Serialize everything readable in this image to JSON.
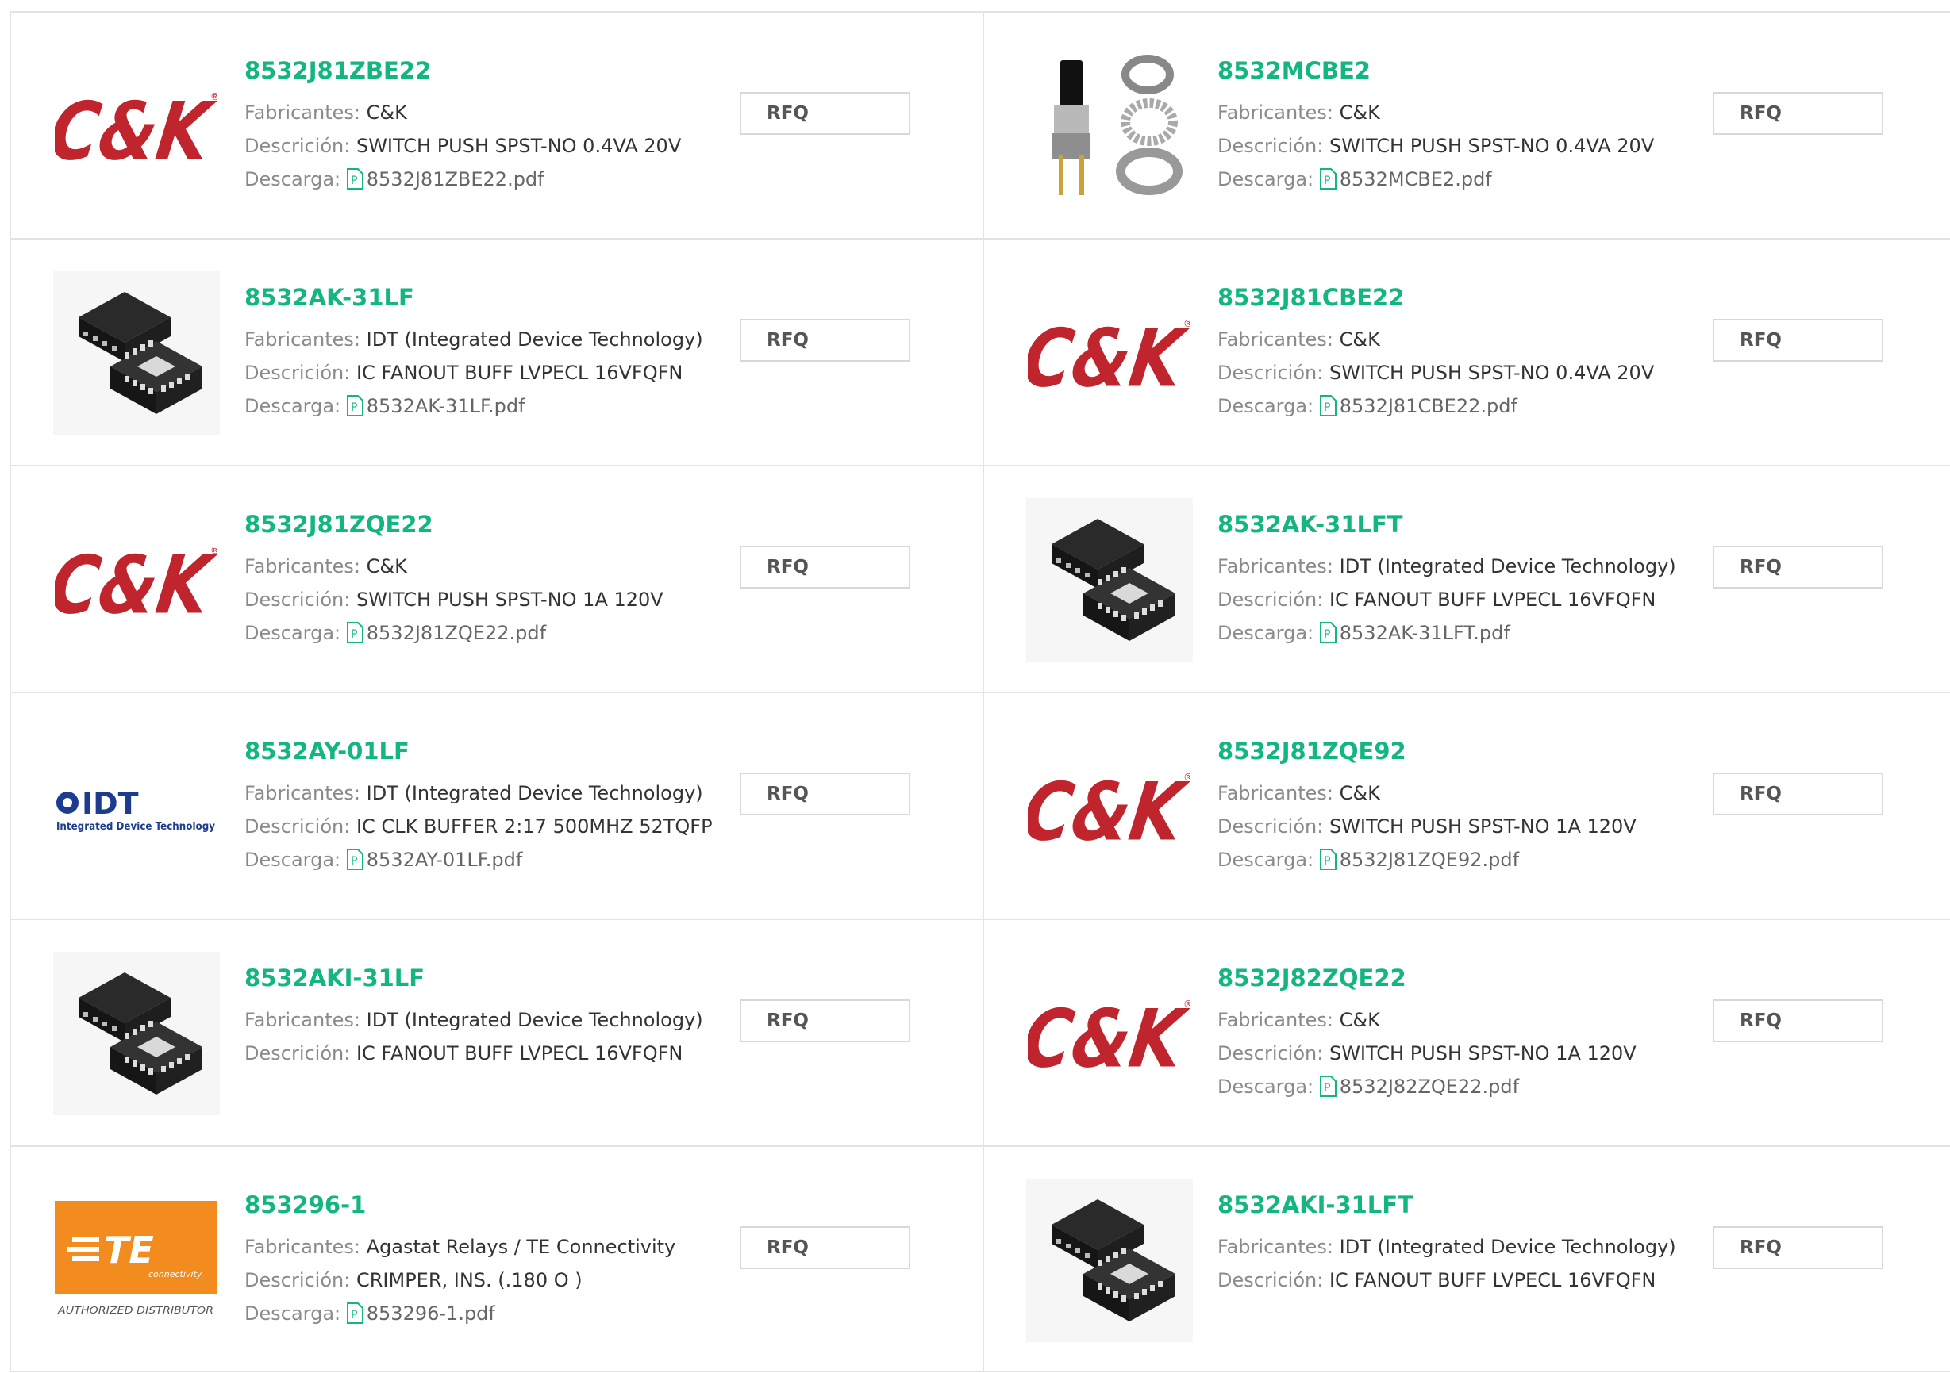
{
  "labels": {
    "manufacturer": "Fabricantes:",
    "description": "Descrición:",
    "download": "Descarga:",
    "rfq": "RFQ"
  },
  "colors": {
    "accent_green": "#13b583",
    "ck_red": "#c0242d",
    "te_orange": "#f28c1f",
    "idt_blue": "#1d3c8f"
  },
  "products": [
    {
      "part": "8532J81ZBE22",
      "manufacturer": "C&K",
      "description": "SWITCH PUSH SPST-NO 0.4VA 20V",
      "file": "8532J81ZBE22.pdf",
      "image": "ck-logo"
    },
    {
      "part": "8532MCBE2",
      "manufacturer": "C&K",
      "description": "SWITCH PUSH SPST-NO 0.4VA 20V",
      "file": "8532MCBE2.pdf",
      "image": "switch-photo"
    },
    {
      "part": "8532AK-31LF",
      "manufacturer": "IDT (Integrated Device Technology)",
      "description": "IC FANOUT BUFF LVPECL 16VFQFN",
      "file": "8532AK-31LF.pdf",
      "image": "chip-photo"
    },
    {
      "part": "8532J81CBE22",
      "manufacturer": "C&K",
      "description": "SWITCH PUSH SPST-NO 0.4VA 20V",
      "file": "8532J81CBE22.pdf",
      "image": "ck-logo"
    },
    {
      "part": "8532J81ZQE22",
      "manufacturer": "C&K",
      "description": "SWITCH PUSH SPST-NO 1A 120V",
      "file": "8532J81ZQE22.pdf",
      "image": "ck-logo"
    },
    {
      "part": "8532AK-31LFT",
      "manufacturer": "IDT (Integrated Device Technology)",
      "description": "IC FANOUT BUFF LVPECL 16VFQFN",
      "file": "8532AK-31LFT.pdf",
      "image": "chip-photo"
    },
    {
      "part": "8532AY-01LF",
      "manufacturer": "IDT (Integrated Device Technology)",
      "description": "IC CLK BUFFER 2:17 500MHZ 52TQFP",
      "file": "8532AY-01LF.pdf",
      "image": "idt-logo"
    },
    {
      "part": "8532J81ZQE92",
      "manufacturer": "C&K",
      "description": "SWITCH PUSH SPST-NO 1A 120V",
      "file": "8532J81ZQE92.pdf",
      "image": "ck-logo"
    },
    {
      "part": "8532AKI-31LF",
      "manufacturer": "IDT (Integrated Device Technology)",
      "description": "IC FANOUT BUFF LVPECL 16VFQFN",
      "file": null,
      "image": "chip-photo"
    },
    {
      "part": "8532J82ZQE22",
      "manufacturer": "C&K",
      "description": "SWITCH PUSH SPST-NO 1A 120V",
      "file": "8532J82ZQE22.pdf",
      "image": "ck-logo"
    },
    {
      "part": "853296-1",
      "manufacturer": "Agastat Relays / TE Connectivity",
      "description": "CRIMPER, INS. (.180 O )",
      "file": "853296-1.pdf",
      "image": "te-logo"
    },
    {
      "part": "8532AKI-31LFT",
      "manufacturer": "IDT (Integrated Device Technology)",
      "description": "IC FANOUT BUFF LVPECL 16VFQFN",
      "file": null,
      "image": "chip-photo"
    }
  ],
  "logo_text": {
    "ck": "C&K",
    "idt": "IDT",
    "idt_sub": "Integrated Device Technology",
    "te": "TE",
    "te_sub": "connectivity",
    "te_badge": "AUTHORIZED DISTRIBUTOR"
  }
}
